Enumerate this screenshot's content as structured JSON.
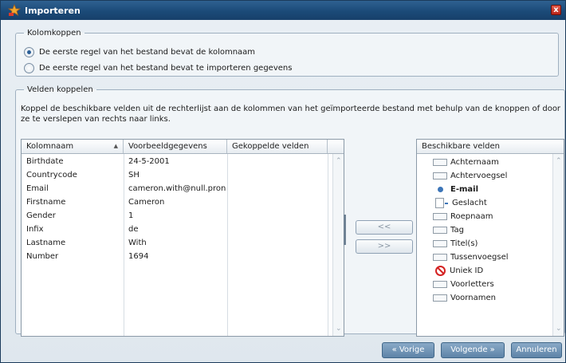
{
  "window": {
    "title": "Importeren",
    "close_label": "x"
  },
  "kolomkoppen": {
    "legend": "Kolomkoppen",
    "options": [
      {
        "label": "De eerste regel van het bestand bevat de kolomnaam",
        "checked": true
      },
      {
        "label": "De eerste regel van het bestand bevat te importeren gegevens",
        "checked": false
      }
    ]
  },
  "velden": {
    "legend": "Velden koppelen",
    "description": "Koppel de beschikbare velden uit de rechterlijst aan de kolommen van het geïmporteerde bestand met behulp van de knoppen of door ze te verslepen van rechts naar links."
  },
  "mapping_table": {
    "headers": [
      "Kolomnaam",
      "Voorbeeldgegevens",
      "Gekoppelde velden"
    ],
    "sort_indicator": "▲",
    "rows": [
      [
        "Birthdate",
        "24-5-2001",
        ""
      ],
      [
        "Countrycode",
        "SH",
        ""
      ],
      [
        "Email",
        "cameron.with@null.pron",
        ""
      ],
      [
        "Firstname",
        "Cameron",
        ""
      ],
      [
        "Gender",
        "1",
        ""
      ],
      [
        "Infix",
        "de",
        ""
      ],
      [
        "Lastname",
        "With",
        ""
      ],
      [
        "Number",
        "1694",
        ""
      ]
    ]
  },
  "buttons": {
    "link": "<<",
    "unlink": ">>"
  },
  "available": {
    "header": "Beschikbare velden",
    "items": [
      {
        "label": "Achternaam",
        "icon": "field-icon",
        "bold": false
      },
      {
        "label": "Achtervoegsel",
        "icon": "field-icon",
        "bold": false
      },
      {
        "label": "E-mail",
        "icon": "email-dot-icon",
        "bold": true
      },
      {
        "label": "Geslacht",
        "icon": "list-field-icon",
        "bold": false
      },
      {
        "label": "Roepnaam",
        "icon": "field-icon",
        "bold": false
      },
      {
        "label": "Tag",
        "icon": "field-icon",
        "bold": false
      },
      {
        "label": "Titel(s)",
        "icon": "field-icon",
        "bold": false
      },
      {
        "label": "Tussenvoegsel",
        "icon": "field-icon",
        "bold": false
      },
      {
        "label": "Uniek ID",
        "icon": "prohibited-icon",
        "bold": false
      },
      {
        "label": "Voorletters",
        "icon": "field-icon",
        "bold": false
      },
      {
        "label": "Voornamen",
        "icon": "field-icon",
        "bold": false
      }
    ]
  },
  "footer": {
    "prev": "« Vorige",
    "next": "Volgende »",
    "cancel": "Annuleren"
  }
}
